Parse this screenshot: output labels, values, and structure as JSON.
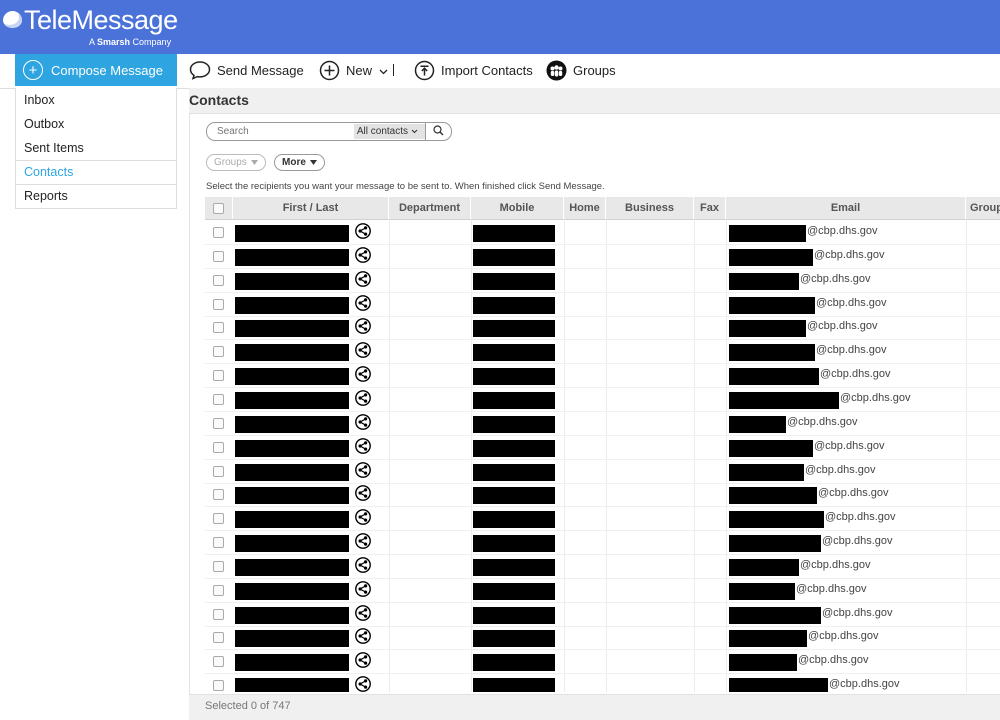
{
  "brand": {
    "name": "TeleMessage",
    "tagline_prefix": "A ",
    "tagline_bold": "Smarsh",
    "tagline_suffix": " Company"
  },
  "toolbar": {
    "compose_label": "Compose Message",
    "send_label": "Send Message",
    "new_label": "New",
    "import_label": "Import Contacts",
    "groups_label": "Groups"
  },
  "sidebar": {
    "items": [
      {
        "label": "Inbox",
        "active": false
      },
      {
        "label": "Outbox",
        "active": false
      },
      {
        "label": "Sent Items",
        "active": false
      },
      {
        "label": "Contacts",
        "active": true
      },
      {
        "label": "Reports",
        "active": false
      }
    ]
  },
  "contacts": {
    "title": "Contacts",
    "search_placeholder": "Search",
    "search_scope": "All contacts",
    "groups_filter": "Groups",
    "more_filter": "More",
    "hint": "Select the recipients you want your message to be sent to. When finished click Send Message.",
    "columns": [
      "First / Last",
      "Department",
      "Mobile",
      "Home",
      "Business",
      "Fax",
      "Email",
      "Group"
    ],
    "email_domain": "@cbp.dhs.gov",
    "redacted_email_lengths": [
      0.7,
      0.76,
      0.64,
      0.78,
      0.7,
      0.78,
      0.82,
      1.0,
      0.52,
      0.76,
      0.68,
      0.8,
      0.86,
      0.84,
      0.64,
      0.6,
      0.84,
      0.71,
      0.62,
      0.9
    ],
    "footer": "Selected 0 of 747"
  },
  "colors": {
    "brand_blue": "#4a72d9",
    "accent": "#2ea5e0"
  },
  "icons": {
    "share": "share-icon",
    "search": "search-icon",
    "chat": "chat-bubble-icon",
    "plus": "plus-circle-icon",
    "import": "upload-icon",
    "groups": "group-icon"
  }
}
